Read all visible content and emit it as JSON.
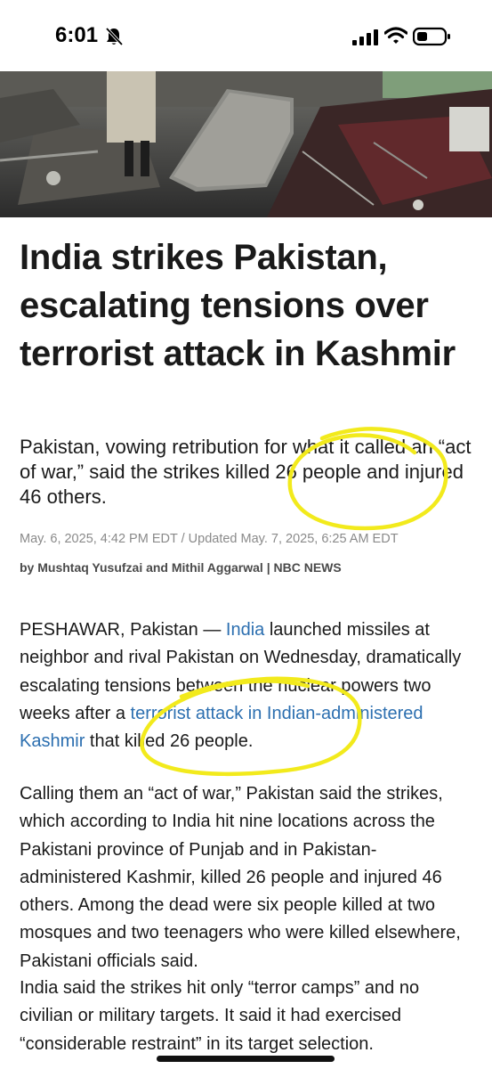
{
  "status_bar": {
    "time": "6:01",
    "icons": [
      "bell-slash-icon",
      "cellular-signal-icon",
      "wifi-icon",
      "battery-icon"
    ]
  },
  "hero_image": {
    "description_icon": "debris-photo"
  },
  "article": {
    "headline": "India strikes Pakistan, escalating tensions over terrorist attack in Kashmir",
    "dek": "Pakistan, vowing retribution for what it called an “act of war,” said the strikes killed 26 people and injured 46 others.",
    "dateline": "May. 6, 2025, 4:42 PM EDT / Updated May. 7, 2025, 6:25 AM EDT",
    "byline": "by Mushtaq Yusufzai and Mithil Aggarwal | NBC NEWS",
    "paragraph1": {
      "lead": "PESHAWAR, Pakistan — ",
      "link1": "India",
      "mid": " launched missiles at neighbor and rival Pakistan on Wednesday, dramati­cally escalating tensions between the nuclear powers two weeks after a ",
      "link2": "terrorist attack in Indian-adminis­tered Kashmir",
      "tail": " that killed 26 people."
    },
    "paragraph2": "Calling them an “act of war,” Pakistan said the strikes, which according to India hit nine locations across the Pakistani province of Punjab and in Pakistan-administered Kashmir, killed 26 people and injured 46 others. Among the dead were six people killed at two mosques and two teenagers who were killed elsewhere, Pakistani officials said.",
    "paragraph3": "India said the strikes hit only “terror camps” and no civilian or military targets. It said it had exercised “considerable restraint” in its target selection."
  },
  "colors": {
    "link": "#2c6fb0",
    "annotation": "#f2ea1c",
    "text": "#1a1a1a",
    "meta": "#8a8a8a"
  }
}
